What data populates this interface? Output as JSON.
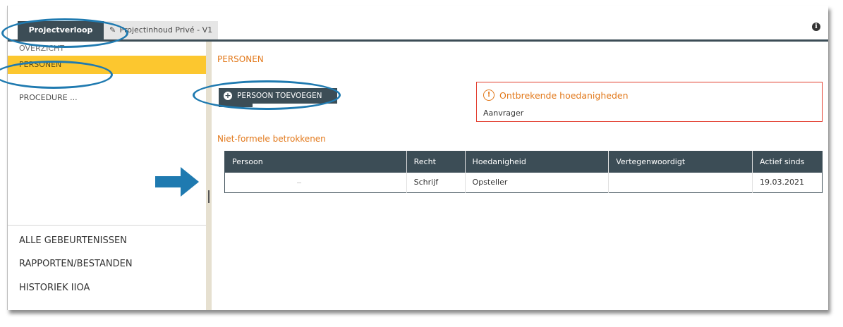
{
  "tabs": {
    "active_label": "Projectverloop",
    "inactive_label": "Projectinhoud Privé - V1"
  },
  "sidebar": {
    "items": [
      {
        "label": "OVERZICHT"
      },
      {
        "label": "PERSONEN"
      },
      {
        "label": "PROCEDURE ..."
      }
    ],
    "bottom_links": [
      {
        "label": "ALLE GEBEURTENISSEN"
      },
      {
        "label": "RAPPORTEN/BESTANDEN"
      },
      {
        "label": "HISTORIEK IIOA"
      }
    ]
  },
  "main": {
    "section_title": "PERSONEN",
    "add_button": "PERSOON TOEVOEGEN",
    "alert": {
      "title": "Ontbrekende hoedanigheden",
      "text": "Aanvrager"
    },
    "subsection_title": "Niet-formele betrokkenen",
    "table": {
      "columns": [
        "Persoon",
        "Recht",
        "Hoedanigheid",
        "Vertegenwoordigt",
        "Actief sinds"
      ],
      "rows": [
        [
          "",
          "Schrijf",
          "Opsteller",
          "",
          "19.03.2021"
        ]
      ]
    }
  },
  "colors": {
    "header_dark": "#3c4d56",
    "selected_yellow": "#fcc72f",
    "accent_orange": "#e2781a",
    "alert_red": "#e23b2d",
    "annotation_blue": "#1f7ab0"
  },
  "icons": [
    "pencil-icon",
    "info-icon",
    "plus-circle-icon",
    "warning-circle-icon",
    "annotation-arrow-icon"
  ]
}
